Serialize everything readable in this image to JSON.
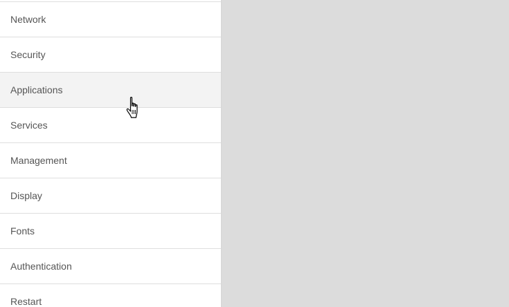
{
  "sidebar": {
    "items": [
      {
        "label": "Network"
      },
      {
        "label": "Security"
      },
      {
        "label": "Applications"
      },
      {
        "label": "Services"
      },
      {
        "label": "Management"
      },
      {
        "label": "Display"
      },
      {
        "label": "Fonts"
      },
      {
        "label": "Authentication"
      },
      {
        "label": "Restart"
      }
    ],
    "hovered_item": "Applications"
  },
  "cursor": {
    "icon": "hand-pointer-icon"
  },
  "colors": {
    "sidebar_background": "#ffffff",
    "hover_background": "#f3f3f3",
    "content_background": "#dcdcdc",
    "text": "#555555",
    "divider": "#dedede"
  }
}
